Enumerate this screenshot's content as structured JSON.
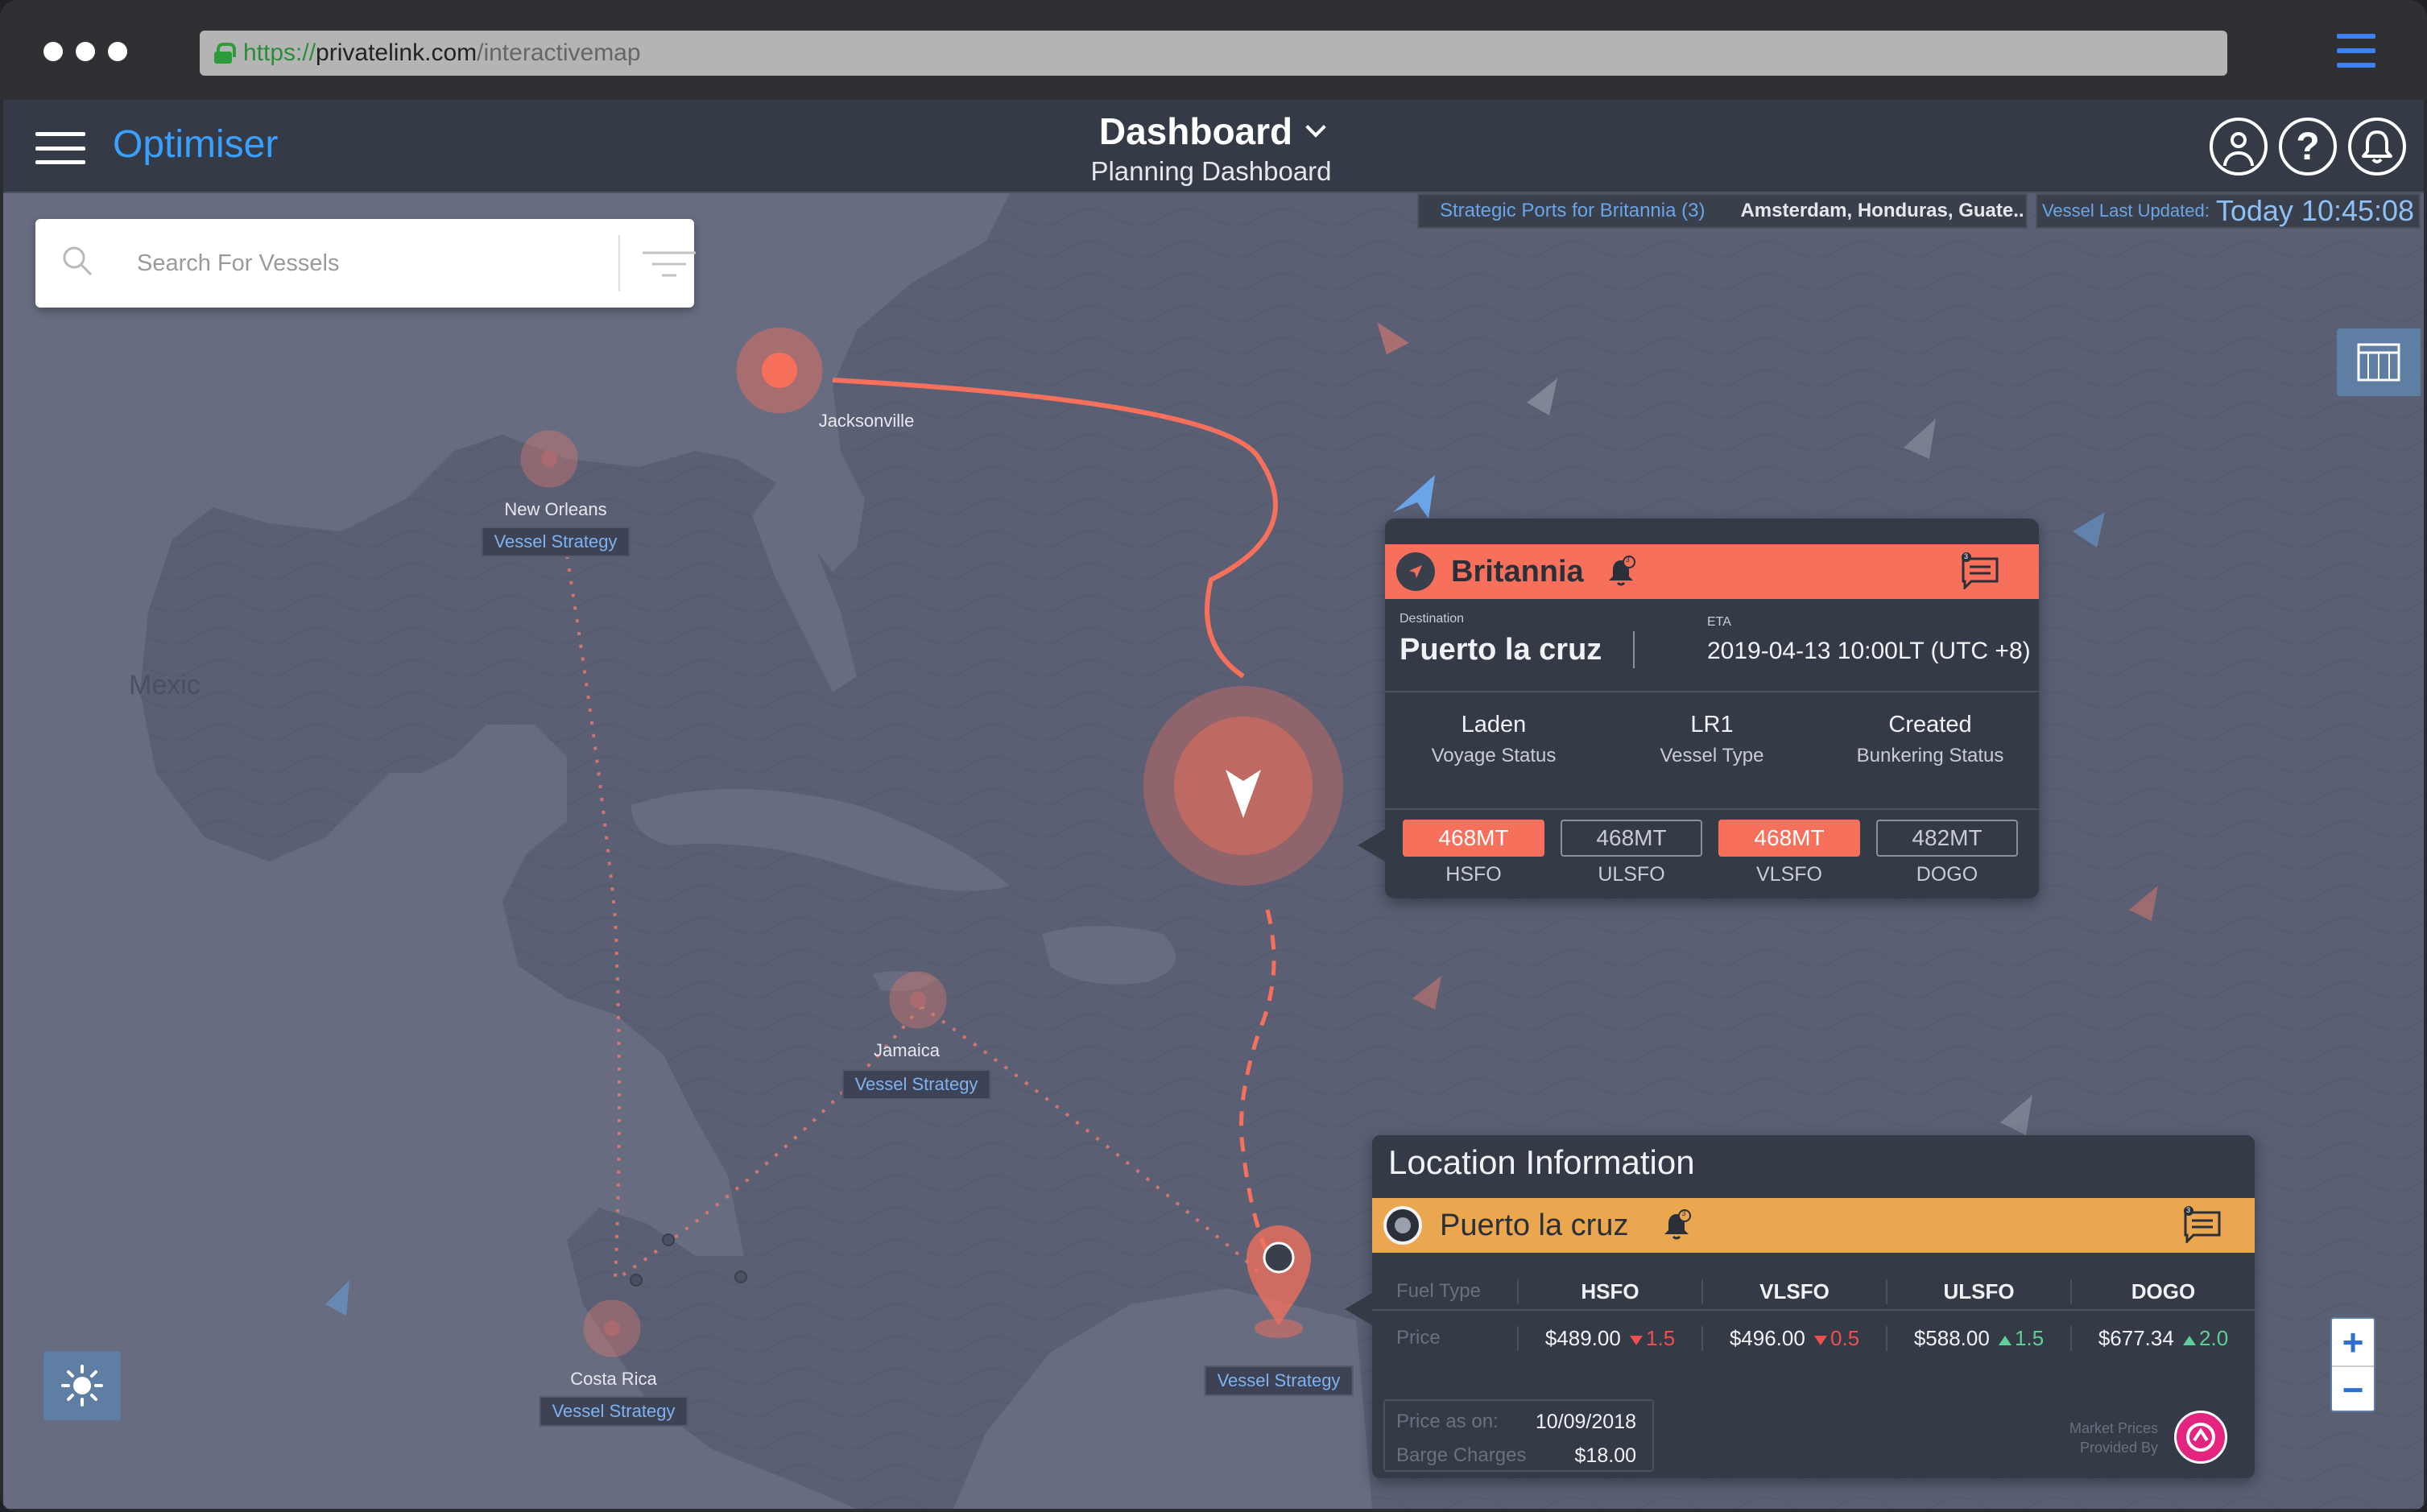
{
  "browser": {
    "url_protocol": "https://",
    "url_host": "privatelink.com",
    "url_path": "/interactivemap"
  },
  "header": {
    "brand": "Optimiser",
    "title": "Dashboard",
    "subtitle": "Planning Dashboard",
    "icons": [
      "user-icon",
      "help-icon",
      "bell-icon"
    ],
    "help_glyph": "?"
  },
  "search": {
    "placeholder": "Search For Vessels"
  },
  "strategic_ports": {
    "label": "Strategic Ports for Britannia (3)",
    "ports": "Amsterdam, Honduras, Guate.."
  },
  "last_updated": {
    "label": "Vessel Last Updated:",
    "value": "Today 10:45:08"
  },
  "map": {
    "country_label": "Mexic",
    "ports": [
      {
        "name": "Jacksonville",
        "tag": ""
      },
      {
        "name": "New Orleans",
        "tag": "Vessel Strategy"
      },
      {
        "name": "Jamaica",
        "tag": "Vessel Strategy"
      },
      {
        "name": "Costa Rica",
        "tag": "Vessel Strategy"
      },
      {
        "name": "",
        "tag": "Vessel Strategy"
      }
    ]
  },
  "vessel": {
    "name": "Britannia",
    "alert_count": "3",
    "message_count": "3",
    "destination_label": "Destination",
    "destination": "Puerto la cruz",
    "eta_label": "ETA",
    "eta": "2019-04-13 10:00LT (UTC +8)",
    "stats": [
      {
        "value": "Laden",
        "label": "Voyage Status"
      },
      {
        "value": "LR1",
        "label": "Vessel Type"
      },
      {
        "value": "Created",
        "label": "Bunkering Status"
      }
    ],
    "fuels": [
      {
        "amount": "468MT",
        "type": "HSFO",
        "active": true
      },
      {
        "amount": "468MT",
        "type": "ULSFO",
        "active": false
      },
      {
        "amount": "468MT",
        "type": "VLSFO",
        "active": true
      },
      {
        "amount": "482MT",
        "type": "DOGO",
        "active": false
      }
    ]
  },
  "location": {
    "title": "Location Information",
    "name": "Puerto la cruz",
    "alert_count": "3",
    "message_count": "3",
    "fuel_type_label": "Fuel Type",
    "price_label": "Price",
    "columns": [
      "HSFO",
      "VLSFO",
      "ULSFO",
      "DOGO"
    ],
    "prices": [
      {
        "price": "$489.00",
        "change": "1.5",
        "direction": "down"
      },
      {
        "price": "$496.00",
        "change": "0.5",
        "direction": "down"
      },
      {
        "price": "$588.00",
        "change": "1.5",
        "direction": "up"
      },
      {
        "price": "$677.34",
        "change": "2.0",
        "direction": "up"
      }
    ],
    "price_as_on_label": "Price as on:",
    "price_as_on": "10/09/2018",
    "barge_label": "Barge Charges",
    "barge": "$18.00",
    "market_line1": "Market Prices",
    "market_line2": "Provided By"
  },
  "zoom": {
    "in": "+",
    "out": "−"
  },
  "colors": {
    "accent_red": "#f7705c",
    "accent_orange": "#eaa74f",
    "brand_blue": "#3aa0ff",
    "map_bg": "#5a5f74"
  }
}
